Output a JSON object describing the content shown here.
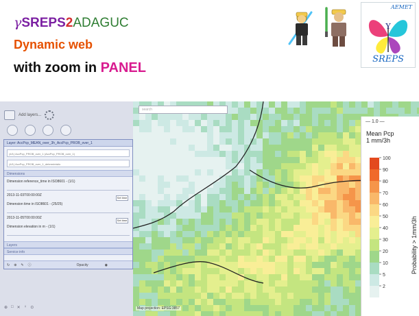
{
  "header": {
    "gamma": "γ",
    "sreps": "SREPS",
    "two": "2",
    "adaguc": "ADAGUC",
    "subtitle1": "Dynamic web",
    "subtitle2_prefix": "with zoom in ",
    "subtitle2_panel": "PANEL",
    "logo_org": "AEMET",
    "logo_text": "SREPS"
  },
  "toolbar": {
    "add_layers": "Add layers..."
  },
  "layer_panel": {
    "header": "Layer: AccPcp_MEAN_over_3h_AccPcp_PROB_over_1",
    "select1": "(4/1) AccPcp_PROB_over_1 (AccPcp_PROB_over_1)",
    "select2": "(4/1) AccPcp_PROB_over_1_deterministic",
    "dimensions": "Dimensions",
    "ref_time_label": "Dimension reference_time in ISO8601 - (1/1)",
    "ref_time_value": "2013-11-03T00:00:00Z",
    "time_label": "Dimension time in ISO8601 - (25/25)",
    "time_value": "2013-11-05T00:00:00Z",
    "elev_label": "Dimension elevation in m - (1/1)",
    "set_time": "Set time",
    "layers": "Layers",
    "service_info": "Service info",
    "opacity": "Opacity"
  },
  "map": {
    "search_placeholder": "search",
    "scale_note": "Map projection: EPSG:3857"
  },
  "legend": {
    "contour": "1.0",
    "title_lines": [
      "Mean Pcp",
      "1 mm/3h"
    ],
    "axis": "Probability > 1mm/3h",
    "ticks": [
      100,
      90,
      80,
      70,
      60,
      50,
      40,
      30,
      20,
      10,
      5,
      2
    ],
    "colors": [
      "#e34a1f",
      "#f06a2a",
      "#f5954a",
      "#f9b86a",
      "#fbd884",
      "#f9ee97",
      "#e4ef8e",
      "#c4e580",
      "#9fd78a",
      "#a9dcc2",
      "#cde9e4",
      "#e6f2f0"
    ]
  }
}
